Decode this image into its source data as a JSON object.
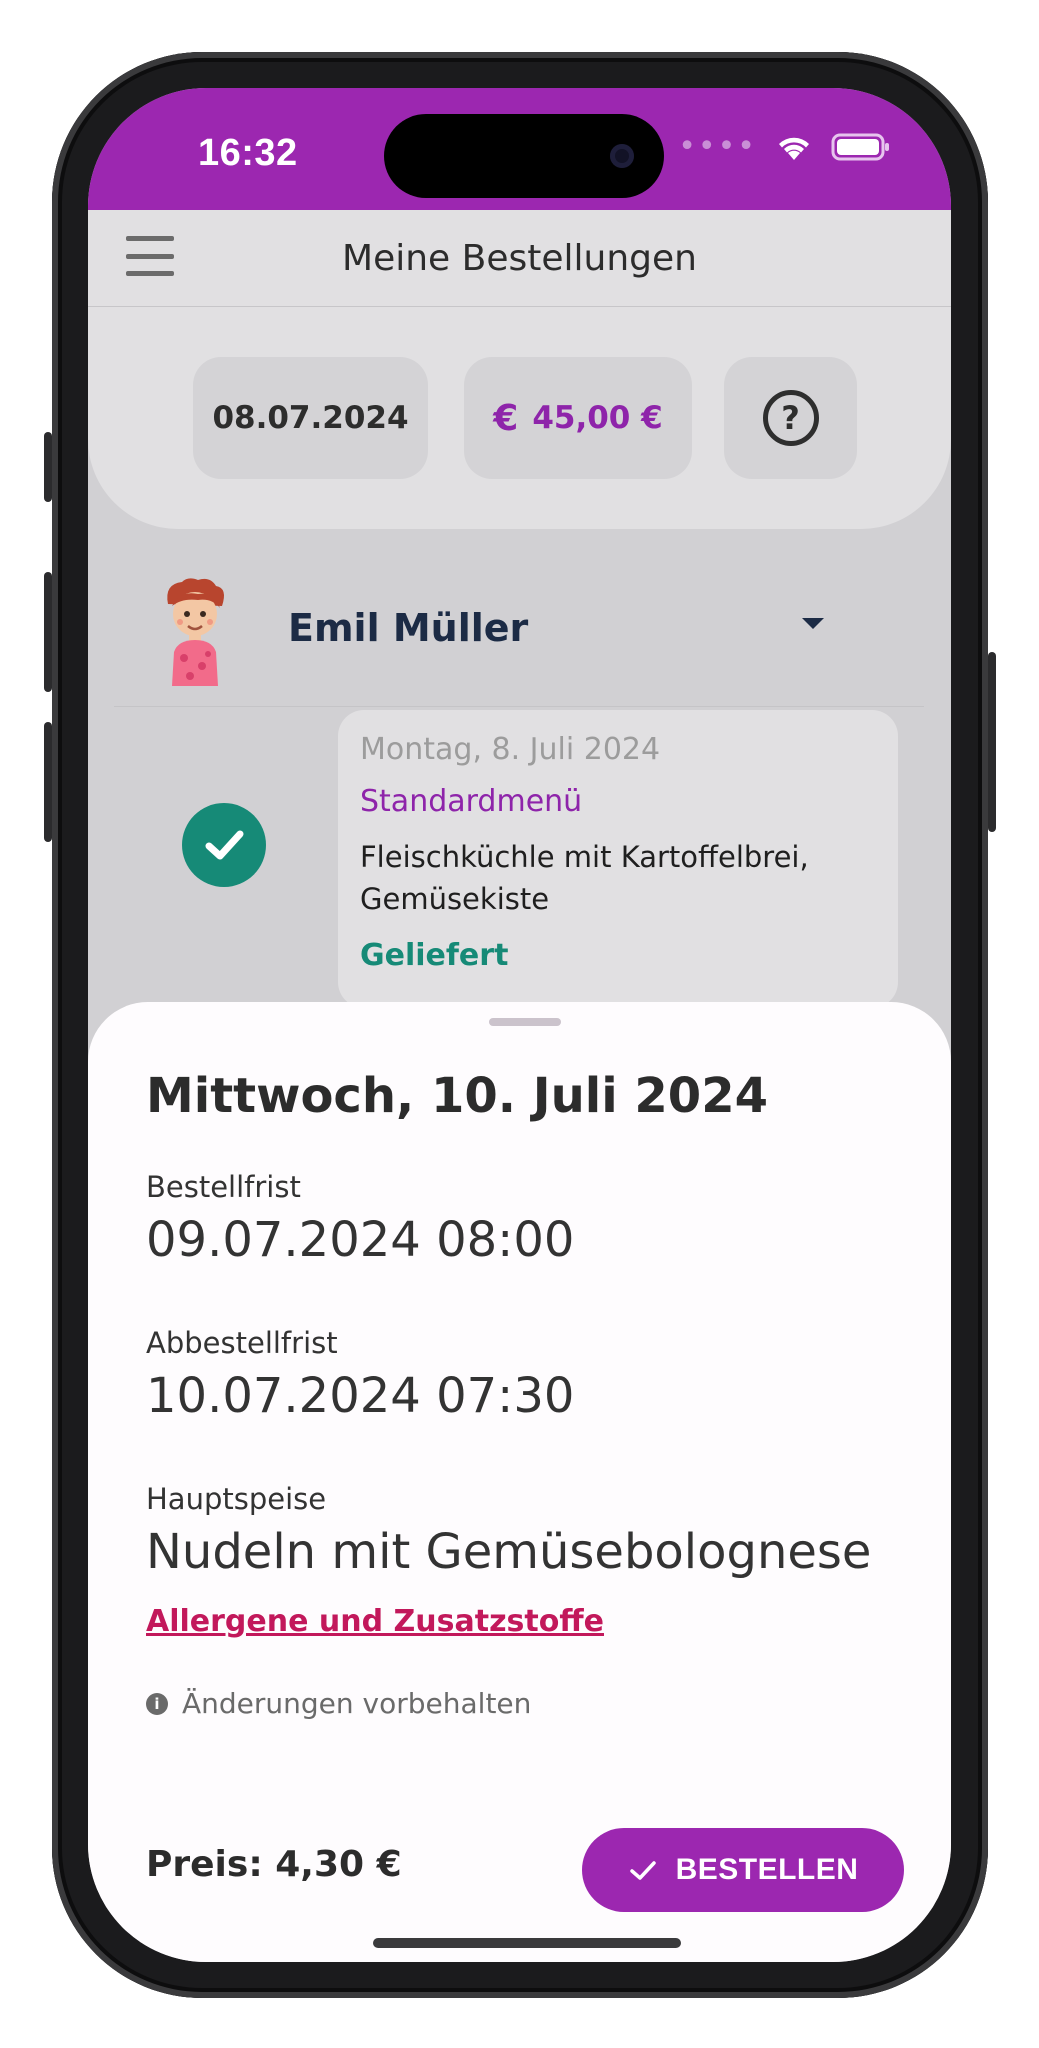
{
  "status_bar": {
    "time": "16:32"
  },
  "app_bar": {
    "title": "Meine Bestellungen"
  },
  "summary": {
    "date": "08.07.2024",
    "balance": "45,00 €",
    "currency_symbol": "€",
    "help_symbol": "?"
  },
  "child": {
    "name": "Emil Müller"
  },
  "order_card": {
    "date": "Montag, 8. Juli 2024",
    "menu": "Standardmenü",
    "dish": "Fleischküchle mit Kartoffelbrei, Gemüsekiste",
    "status": "Geliefert"
  },
  "sheet": {
    "title": "Mittwoch, 10. Juli 2024",
    "order_deadline_label": "Bestellfrist",
    "order_deadline_value": "09.07.2024 08:00",
    "cancel_deadline_label": "Abbestellfrist",
    "cancel_deadline_value": "10.07.2024 07:30",
    "main_dish_label": "Hauptspeise",
    "main_dish_value": "Nudeln mit Gemüsebolognese",
    "allergen_link": "Allergene und Zusatzstoffe",
    "note": "Änderungen vorbehalten",
    "price": "Preis: 4,30 €",
    "order_button": "BESTELLEN"
  },
  "colors": {
    "brand": "#9c27b0",
    "success": "#168a77",
    "link": "#c2185b"
  },
  "icons": [
    "menu-icon",
    "help-icon",
    "euro-icon",
    "caret-down-icon",
    "check-icon",
    "info-icon",
    "wifi-icon",
    "battery-icon"
  ]
}
